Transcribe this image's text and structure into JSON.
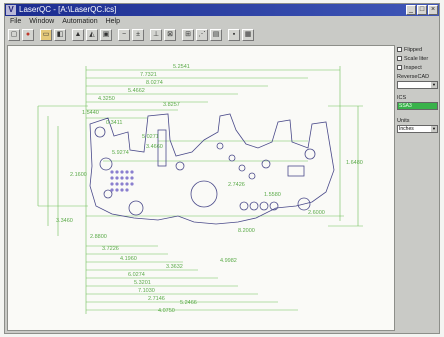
{
  "window": {
    "title": "LaserQC - [A:\\LaserQC.ics]"
  },
  "titlebar_buttons": [
    "_",
    "□",
    "×"
  ],
  "menu": [
    "File",
    "Window",
    "Automation",
    "Help"
  ],
  "toolbar_icons": [
    "open-icon",
    "stop-icon",
    "folder-icon",
    "calibrate-icon",
    "measure-icon",
    "scan-icon",
    "image-icon",
    "minus-icon",
    "align-icon",
    "ruler-icon",
    "compare-icon",
    "report-icon",
    "grid-icon",
    "layer-icon",
    "save-icon",
    "print-icon"
  ],
  "side_panel": {
    "checkboxes": [
      "Flipped",
      "Scale liter",
      "Inspect"
    ],
    "reverse_cad_label": "ReverseCAD",
    "reverse_cad_value": "",
    "ics_label": "ICS",
    "ics_value": "SSA3",
    "units_label": "Units",
    "units_value": "Inches"
  },
  "dimensions": [
    "5.2541",
    "7.7321",
    "8.0274",
    "5.4662",
    "4.3250",
    "3.8257",
    "1.5440",
    "0.3411",
    "5.0271",
    "3.4660",
    "5.9274",
    "1.6480",
    "2.1600",
    "2.7426",
    "1.5580",
    "2.6000",
    "3.3460",
    "2.8800",
    "3.7226",
    "4.1960",
    "3.3632",
    "6.0274",
    "5.3201",
    "7.1030",
    "2.7146",
    "5.2466",
    "4.0750",
    "4.9982",
    "8.2000"
  ],
  "colors": {
    "title": "#1b2c8f",
    "dimension": "#6fbf58",
    "part": "#4a4a8a",
    "ics": "#39b24a"
  }
}
